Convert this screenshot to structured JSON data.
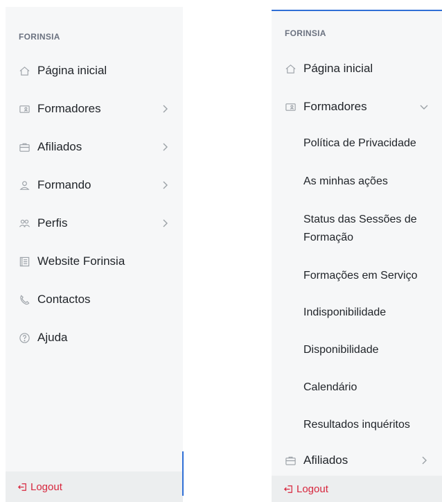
{
  "left": {
    "section": "FORINSIA",
    "items": [
      {
        "label": "Página inicial"
      },
      {
        "label": "Formadores"
      },
      {
        "label": "Afiliados"
      },
      {
        "label": "Formando"
      },
      {
        "label": "Perfis"
      },
      {
        "label": "Website Forinsia"
      },
      {
        "label": "Contactos"
      },
      {
        "label": "Ajuda"
      }
    ],
    "logout": "Logout"
  },
  "right": {
    "section": "FORINSIA",
    "items": [
      {
        "label": "Página inicial"
      },
      {
        "label": "Formadores"
      },
      {
        "label": "Afiliados"
      }
    ],
    "subitems": [
      "Política de Privacidade",
      "As minhas ações",
      "Status das Sessões de Formação",
      "Formações em Serviço",
      "Indisponibilidade",
      "Disponibilidade",
      "Calendário",
      "Resultados inquéritos"
    ],
    "logout": "Logout"
  },
  "colors": {
    "accent": "#2f6fd6",
    "logout": "#d7263d",
    "panel": "#f6f7f8"
  }
}
